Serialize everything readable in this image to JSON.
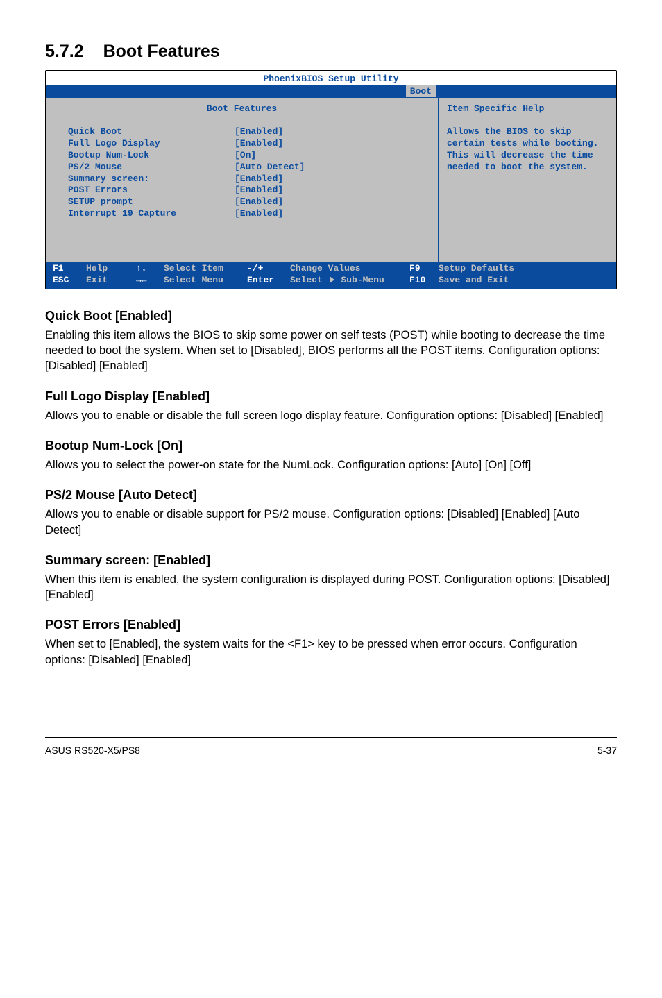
{
  "section": {
    "number": "5.7.2",
    "title": "Boot Features"
  },
  "bios": {
    "utility_title": "PhoenixBIOS Setup Utility",
    "tab": "Boot",
    "panel_title": "Boot Features",
    "help_title": "Item Specific Help",
    "help_text": "Allows the BIOS to skip certain tests while booting. This will decrease the time needed to boot the system.",
    "settings": [
      {
        "label": "Quick Boot",
        "value": "[Enabled]"
      },
      {
        "label": "Full Logo Display",
        "value": "[Enabled]"
      },
      {
        "label": "Bootup Num-Lock",
        "value": "[On]"
      },
      {
        "label": "PS/2 Mouse",
        "value": "[Auto Detect]"
      },
      {
        "label": "Summary screen:",
        "value": "[Enabled]"
      },
      {
        "label": "POST Errors",
        "value": "[Enabled]"
      },
      {
        "label": "SETUP prompt",
        "value": "[Enabled]"
      },
      {
        "label": "Interrupt 19 Capture",
        "value": "[Enabled]"
      }
    ],
    "footer": {
      "r1": {
        "k1": "F1",
        "a1": "Help",
        "n1": "↑↓",
        "nl1": "Select Item",
        "ck1": "-/+",
        "cl1": "Change Values",
        "fk1": "F9",
        "fl1": "Setup Defaults"
      },
      "r2": {
        "k1": "ESC",
        "a1": "Exit",
        "n1": "→←",
        "nl1": "Select Menu",
        "ck1": "Enter",
        "cl1": "Select ",
        "cl1b": " Sub-Menu",
        "fk1": "F10",
        "fl1": "Save and Exit"
      }
    }
  },
  "content": {
    "s1": {
      "h": "Quick Boot [Enabled]",
      "p": "Enabling this item allows the BIOS to skip some power on self tests (POST) while booting to decrease the time needed to boot the system. When set to [Disabled], BIOS performs all the POST items. Configuration options: [Disabled] [Enabled]"
    },
    "s2": {
      "h": "Full Logo Display [Enabled]",
      "p": "Allows you to enable or disable the full screen logo display feature. Configuration options: [Disabled] [Enabled]"
    },
    "s3": {
      "h": "Bootup Num-Lock [On]",
      "p": "Allows you to select the power-on state for the NumLock. Configuration options: [Auto] [On] [Off]"
    },
    "s4": {
      "h": "PS/2 Mouse [Auto Detect]",
      "p": "Allows you to enable or disable support for PS/2 mouse. Configuration options: [Disabled] [Enabled] [Auto Detect]"
    },
    "s5": {
      "h": "Summary screen: [Enabled]",
      "p": "When this item is enabled, the system configuration is displayed during POST. Configuration options: [Disabled] [Enabled]"
    },
    "s6": {
      "h": "POST Errors [Enabled]",
      "p": "When set to [Enabled], the system waits for the <F1> key to be pressed when error occurs. Configuration options: [Disabled] [Enabled]"
    }
  },
  "page_footer": {
    "left": "ASUS RS520-X5/PS8",
    "right": "5-37"
  }
}
